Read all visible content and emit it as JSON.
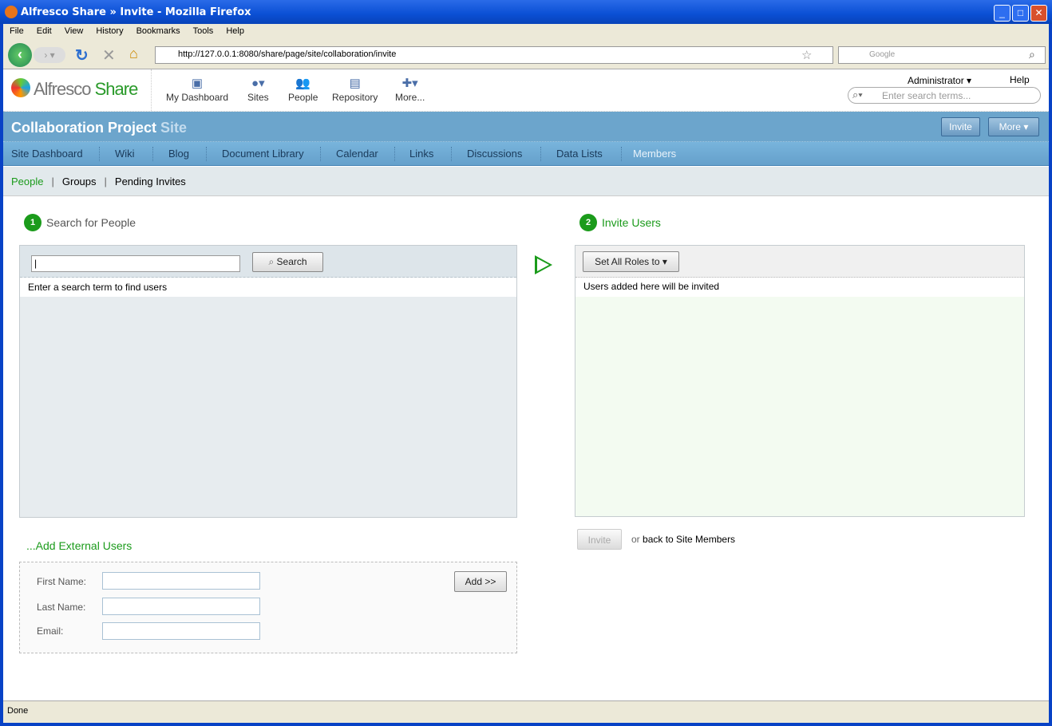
{
  "window": {
    "title": "Alfresco Share » Invite - Mozilla Firefox"
  },
  "menu": [
    "File",
    "Edit",
    "View",
    "History",
    "Bookmarks",
    "Tools",
    "Help"
  ],
  "browser": {
    "url": "http://127.0.0.1:8080/share/page/site/collaboration/invite",
    "search_placeholder": "Google",
    "status": "Done"
  },
  "app": {
    "logo": "Alfresco Share",
    "nav": [
      {
        "label": "My Dashboard",
        "icon": "dashboard-icon"
      },
      {
        "label": "Sites",
        "icon": "globe-icon"
      },
      {
        "label": "People",
        "icon": "people-icon"
      },
      {
        "label": "Repository",
        "icon": "repository-icon"
      },
      {
        "label": "More...",
        "icon": "plus-icon"
      }
    ],
    "user": "Administrator",
    "help": "Help",
    "search_placeholder": "Enter search terms..."
  },
  "site": {
    "title": "Collaboration Project",
    "title_suffix": "Site",
    "invite": "Invite",
    "more": "More",
    "nav": [
      "Site Dashboard",
      "Wiki",
      "Blog",
      "Document Library",
      "Calendar",
      "Links",
      "Discussions",
      "Data Lists",
      "Members"
    ]
  },
  "subnav": [
    "People",
    "Groups",
    "Pending Invites"
  ],
  "search": {
    "step": "1",
    "title": "Search for People",
    "button": "Search",
    "empty": "Enter a search term to find users"
  },
  "invite": {
    "step": "2",
    "title": "Invite Users",
    "set_roles": "Set All Roles to",
    "empty": "Users added here will be invited",
    "invite_button": "Invite",
    "or": "or",
    "back_link": "back to Site Members"
  },
  "external": {
    "title": "...Add External Users",
    "first": "First Name:",
    "last": "Last Name:",
    "email": "Email:",
    "add": "Add >>"
  },
  "colors": {
    "accent": "#1b9b1b",
    "site_bar": "#6ca5cc"
  }
}
